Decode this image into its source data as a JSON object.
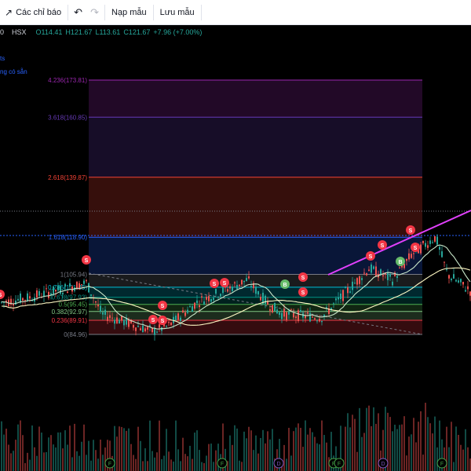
{
  "toolbar": {
    "indicators_label": "Các chỉ báo",
    "templates_label": "Nạp mẫu",
    "save_label": "Lưu mẫu"
  },
  "legend": {
    "symbol_tail": "0",
    "exchange": "HSX",
    "open": "O114.41",
    "high": "H121.67",
    "low": "L113.61",
    "close": "C121.67",
    "change": "+7.96 (+7.00%)"
  },
  "side_notes": [
    "ts",
    "ng có sẵn"
  ],
  "colors": {
    "up": "#26a69a",
    "down": "#ef5350",
    "trendline": "#e040fb"
  },
  "fib_levels": [
    {
      "label": "4.236(173.81)",
      "ratio": 4.236,
      "price": 173.81,
      "color": "#9c27b0"
    },
    {
      "label": "3.618(160.85)",
      "ratio": 3.618,
      "price": 160.85,
      "color": "#673ab7"
    },
    {
      "label": "2.618(139.87)",
      "ratio": 2.618,
      "price": 139.87,
      "color": "#f44336"
    },
    {
      "label": "1.618(118.90)",
      "ratio": 1.618,
      "price": 118.9,
      "color": "#2962ff"
    },
    {
      "label": "1(105.94)",
      "ratio": 1,
      "price": 105.94,
      "color": "#787b86"
    },
    {
      "label": "0.786(101.45)",
      "ratio": 0.786,
      "price": 101.45,
      "color": "#00bcd4"
    },
    {
      "label": "0.618(97.93)",
      "ratio": 0.618,
      "price": 97.93,
      "color": "#009688"
    },
    {
      "label": "0.5(95.45)",
      "ratio": 0.5,
      "price": 95.45,
      "color": "#4caf50"
    },
    {
      "label": "0.382(92.97)",
      "ratio": 0.382,
      "price": 92.97,
      "color": "#81c784"
    },
    {
      "label": "0.236(89.91)",
      "ratio": 0.236,
      "price": 89.91,
      "color": "#f23645"
    },
    {
      "label": "0(84.96)",
      "ratio": 0,
      "price": 84.96,
      "color": "#787b86"
    }
  ],
  "signals": [
    {
      "type": "S",
      "color": "#f23645"
    },
    {
      "type": "S",
      "color": "#f23645"
    },
    {
      "type": "S",
      "color": "#f23645"
    },
    {
      "type": "S",
      "color": "#f23645"
    },
    {
      "type": "S",
      "color": "#f23645"
    },
    {
      "type": "S",
      "color": "#f23645"
    },
    {
      "type": "S",
      "color": "#f23645"
    },
    {
      "type": "B",
      "color": "#66bb6a"
    },
    {
      "type": "S",
      "color": "#f23645"
    },
    {
      "type": "S",
      "color": "#f23645"
    },
    {
      "type": "S",
      "color": "#f23645"
    },
    {
      "type": "S",
      "color": "#f23645"
    },
    {
      "type": "B",
      "color": "#66bb6a"
    },
    {
      "type": "S",
      "color": "#f23645"
    },
    {
      "type": "S",
      "color": "#f23645"
    }
  ],
  "events": [
    "F",
    "F",
    "D",
    "F",
    "F",
    "D",
    "F"
  ]
}
